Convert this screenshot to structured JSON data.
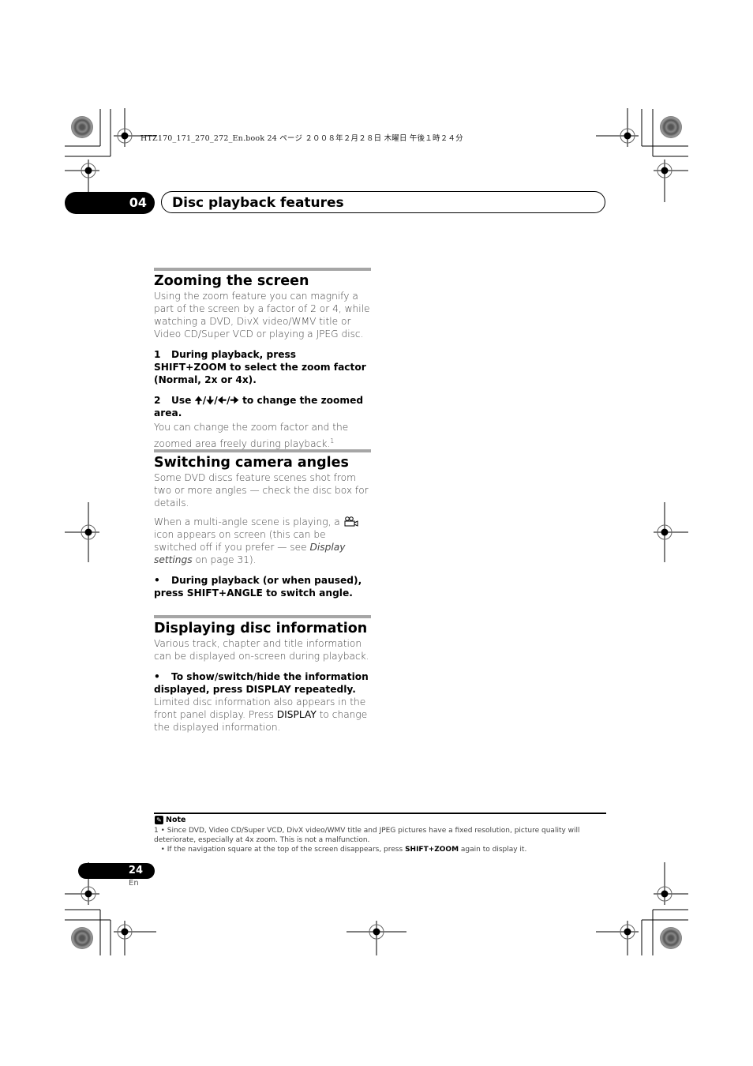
{
  "print_header": "HTZ170_171_270_272_En.book   24 ページ   ２００８年２月２８日   木曜日   午後１時２４分",
  "chapter": {
    "number": "04",
    "title": "Disc playback features"
  },
  "sections": [
    {
      "title": "Zooming the screen",
      "intro": "Using the zoom feature you can magnify a part of the screen by a factor of 2 or 4, while watching a DVD, DivX video/WMV title or Video CD/Super VCD or playing a JPEG disc.",
      "step1_num": "1",
      "step1": "During playback, press SHIFT+ZOOM to select the zoom factor (Normal, 2x or 4x).",
      "step2_num": "2",
      "step2_pre": "Use ",
      "step2_arrows": "🠉/🠋/🠈/🠊",
      "step2_post": " to change the zoomed area.",
      "step2_body": "You can change the zoom factor and the zoomed area freely during playback.",
      "footnote_ref": "1"
    },
    {
      "title": "Switching camera angles",
      "intro": "Some DVD discs feature scenes shot from two or more angles — check the disc box for details.",
      "para2_pre": "When a multi-angle scene is playing, a ",
      "para2_icon": "camera-angle-icon",
      "para2_mid": " icon appears on screen (this can be switched off if you prefer — see ",
      "para2_link": "Display settings",
      "para2_post": " on page 31).",
      "bullet": "•",
      "step": "During playback (or when paused), press SHIFT+ANGLE to switch angle."
    },
    {
      "title": "Displaying disc information",
      "intro": "Various track, chapter and title information can be displayed on-screen during playback.",
      "bullet": "•",
      "step": "To show/switch/hide the information displayed, press DISPLAY repeatedly.",
      "body_pre": "Limited disc information also appears in the front panel display. Press ",
      "body_bold": "DISPLAY",
      "body_post": " to change the displayed information."
    }
  ],
  "note": {
    "title": "Note",
    "line1": "1  • Since DVD, Video CD/Super VCD, DivX video/WMV title and JPEG pictures have a fixed resolution, picture quality will deteriorate, especially at 4x zoom. This is not a malfunction.",
    "line2_pre": "   • If the navigation square at the top of the screen disappears, press ",
    "line2_bold": "SHIFT+ZOOM",
    "line2_post": " again to display it."
  },
  "page": {
    "number": "24",
    "lang": "En"
  }
}
